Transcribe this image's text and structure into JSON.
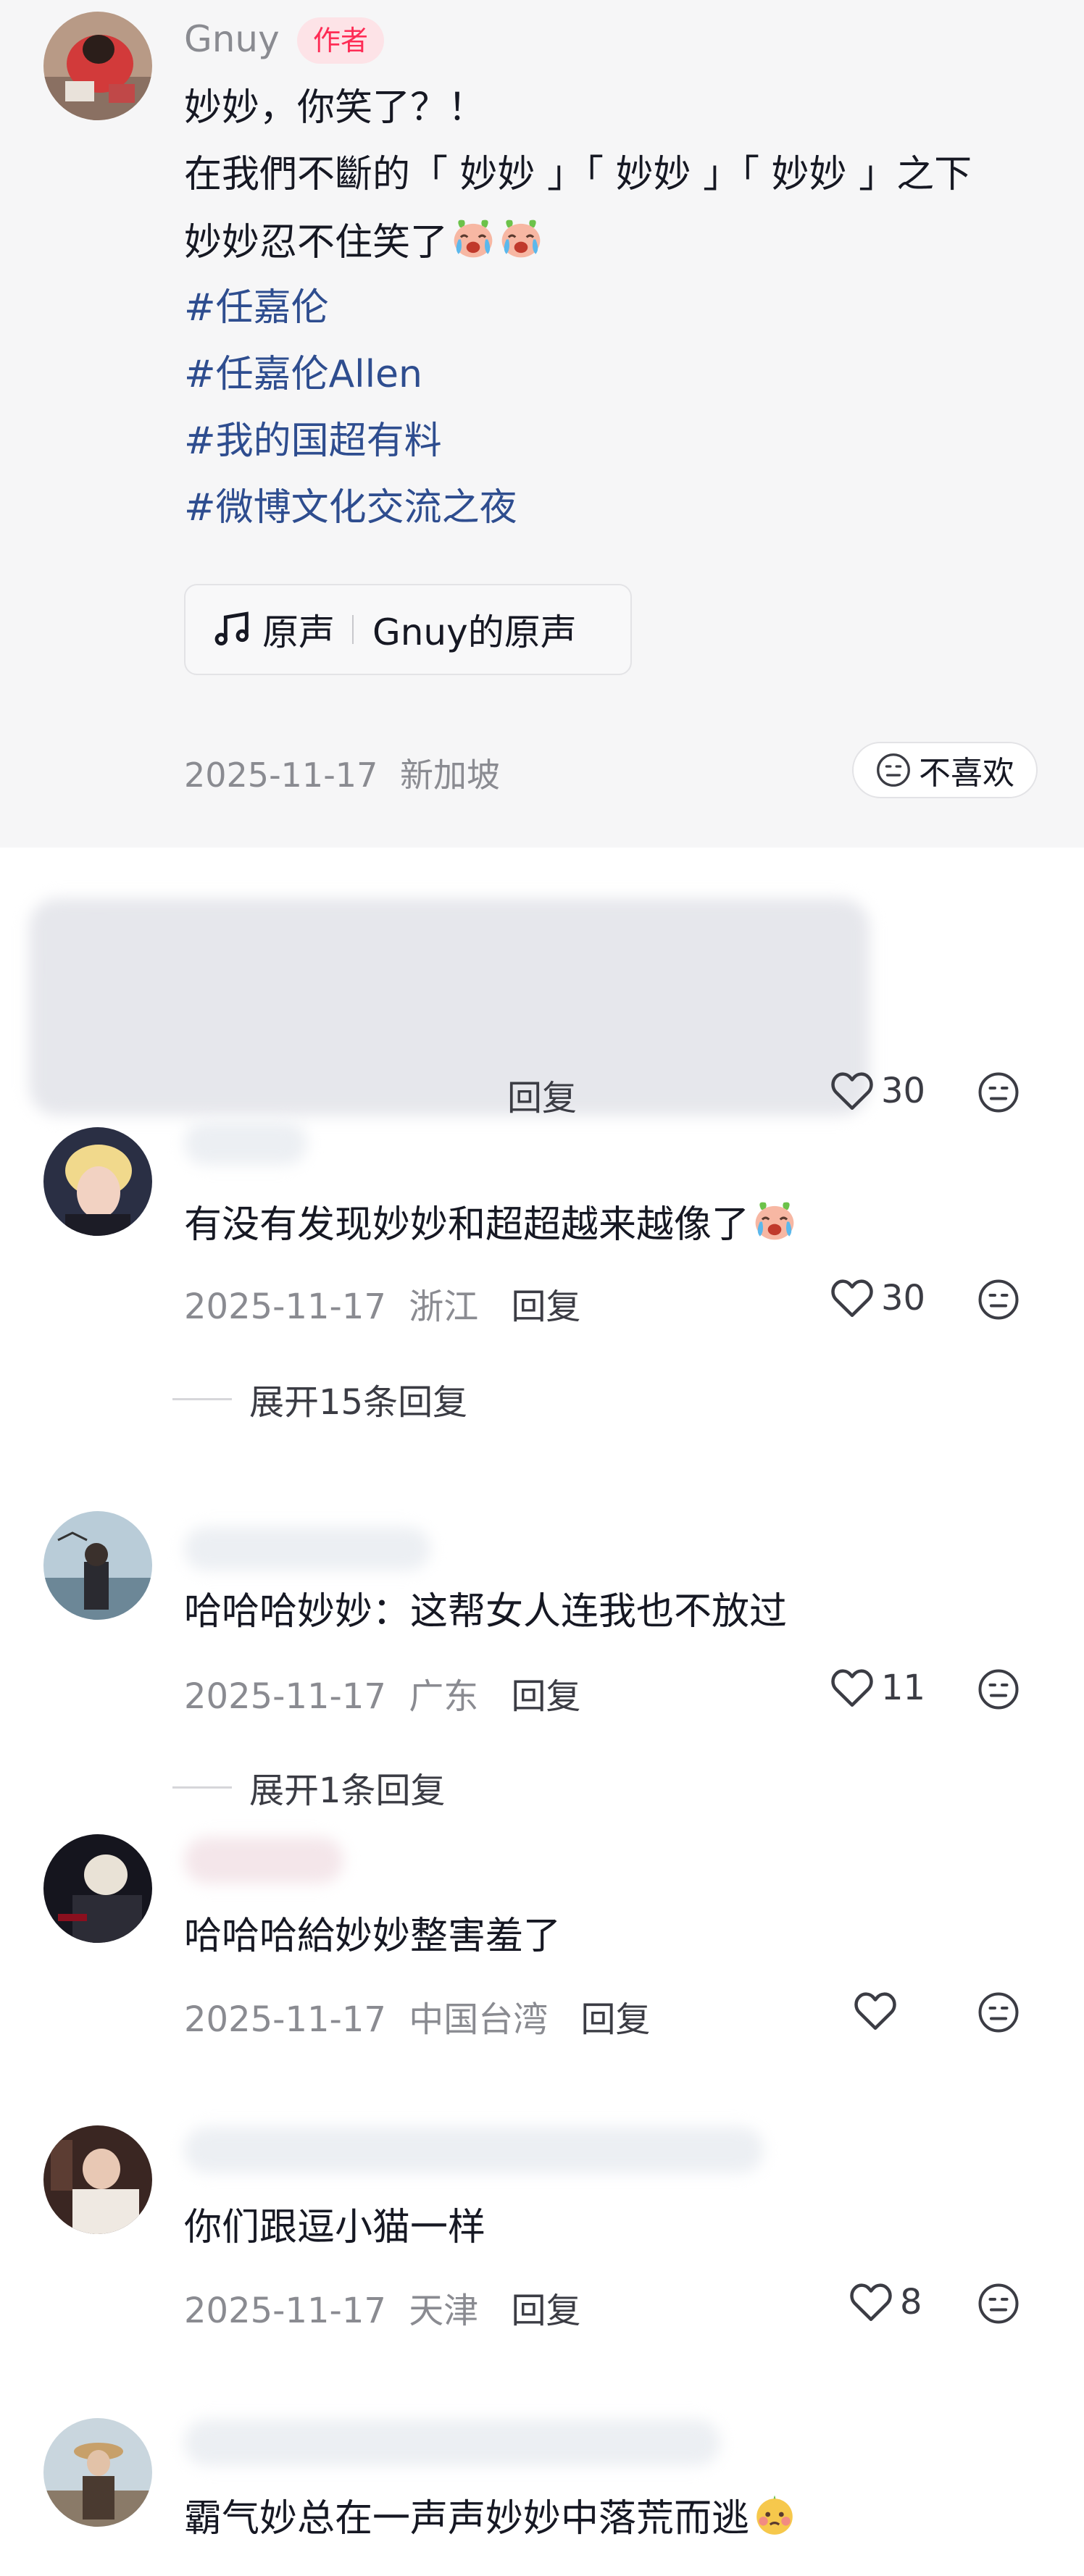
{
  "post": {
    "author": "Gnuy",
    "author_badge": "作者",
    "lines": [
      "妙妙，你笑了？！",
      "在我們不斷的「 妙妙 」「 妙妙 」「 妙妙 」之下",
      "妙妙忍不住笑了"
    ],
    "hashtags": [
      "#任嘉伦",
      "#任嘉伦Allen",
      "#我的国超有料",
      "#微博文化交流之夜"
    ],
    "music": {
      "label": "原声",
      "source": "Gnuy的原声"
    },
    "date": "2025-11-17",
    "location": "新加坡",
    "dislike_label": "不喜欢"
  },
  "comments": [
    {
      "text": "",
      "date": "",
      "location": "",
      "reply": "回复",
      "likes": "30"
    },
    {
      "text": "有没有发现妙妙和超超越来越像了",
      "date": "2025-11-17",
      "location": "浙江",
      "reply": "回复",
      "likes": "30",
      "expand": "展开15条回复"
    },
    {
      "text": "哈哈哈妙妙：这帮女人连我也不放过",
      "date": "2025-11-17",
      "location": "广东",
      "reply": "回复",
      "likes": "11",
      "expand": "展开1条回复"
    },
    {
      "text": "哈哈哈給妙妙整害羞了",
      "date": "2025-11-17",
      "location": "中国台湾",
      "reply": "回复",
      "likes": ""
    },
    {
      "text": "你们跟逗小猫一样",
      "date": "2025-11-17",
      "location": "天津",
      "reply": "回复",
      "likes": "8"
    },
    {
      "text": "霸气妙总在一声声妙妙中落荒而逃",
      "date": "",
      "location": "",
      "reply": "",
      "likes": ""
    }
  ],
  "colors": {
    "hashtag": "#2e4d8f",
    "badge_text": "#fe2c55",
    "badge_bg": "#fde3e7",
    "meta": "#8a8b91"
  },
  "icons": [
    "music-note-icon",
    "dislike-face-icon",
    "heart-icon",
    "crying-laugh-emoji",
    "shy-emoji"
  ]
}
